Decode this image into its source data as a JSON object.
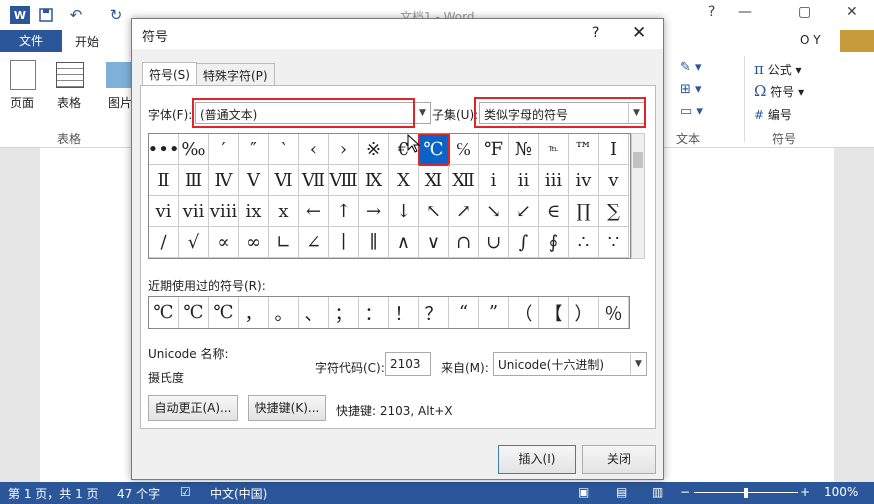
{
  "word": {
    "logo": "W",
    "doc_title": "文档1 - Word",
    "tabs": {
      "file": "文件",
      "home": "开始"
    },
    "user": "O Y",
    "window_controls": {
      "help": "?",
      "minimize": "—",
      "restore": "▢",
      "close": "✕"
    },
    "ribbon": {
      "page_label": "页面",
      "table_label": "表格",
      "image_label": "图片",
      "group_table": "表格",
      "group_text": "文本",
      "group_symbol": "符号",
      "formula_label": "公式",
      "symbol_label": "符号",
      "numbering_label": "编号"
    },
    "status": {
      "page": "第 1 页，共 1 页",
      "words": "47 个字",
      "language": "中文(中国)",
      "zoom": "100%",
      "zoom_minus": "−",
      "zoom_plus": "+"
    }
  },
  "dialog": {
    "title": "符号",
    "help": "?",
    "close": "✕",
    "tabs": [
      "符号(S)",
      "特殊字符(P)"
    ],
    "font_label": "字体(F):",
    "font_value": "(普通文本)",
    "subset_label": "子集(U):",
    "subset_value": "类似字母的符号",
    "symbols": [
      "•••",
      "‰",
      "′",
      "″",
      "‵",
      "‹",
      "›",
      "※",
      "€",
      "℃",
      "℅",
      "℉",
      "№",
      "℡",
      "™",
      "Ⅰ",
      "Ⅱ",
      "Ⅲ",
      "Ⅳ",
      "Ⅴ",
      "Ⅵ",
      "Ⅶ",
      "Ⅷ",
      "Ⅸ",
      "Ⅹ",
      "Ⅺ",
      "Ⅻ",
      "ⅰ",
      "ⅱ",
      "ⅲ",
      "ⅳ",
      "ⅴ",
      "ⅵ",
      "ⅶ",
      "ⅷ",
      "ⅸ",
      "ⅹ",
      "←",
      "↑",
      "→",
      "↓",
      "↖",
      "↗",
      "↘",
      "↙",
      "∈",
      "∏",
      "∑",
      "∕",
      "√",
      "∝",
      "∞",
      "∟",
      "∠",
      "∣",
      "∥",
      "∧",
      "∨",
      "∩",
      "∪",
      "∫",
      "∮",
      "∴",
      "∵"
    ],
    "selected_index": 9,
    "recent_label": "近期使用过的符号(R):",
    "recent": [
      "℃",
      "℃",
      "℃",
      "，",
      "。",
      "、",
      "；",
      "：",
      "！",
      "？",
      "“",
      "”",
      "（",
      "【",
      "）",
      "％"
    ],
    "unicode_name_label": "Unicode 名称:",
    "unicode_name": "摄氏度",
    "char_code_label": "字符代码(C):",
    "char_code": "2103",
    "from_label": "来自(M):",
    "from_value": "Unicode(十六进制)",
    "autocorrect_button": "自动更正(A)...",
    "shortcut_button": "快捷键(K)...",
    "shortcut_text": "快捷键: 2103, Alt+X",
    "insert_button": "插入(I)",
    "close_button": "关闭"
  }
}
